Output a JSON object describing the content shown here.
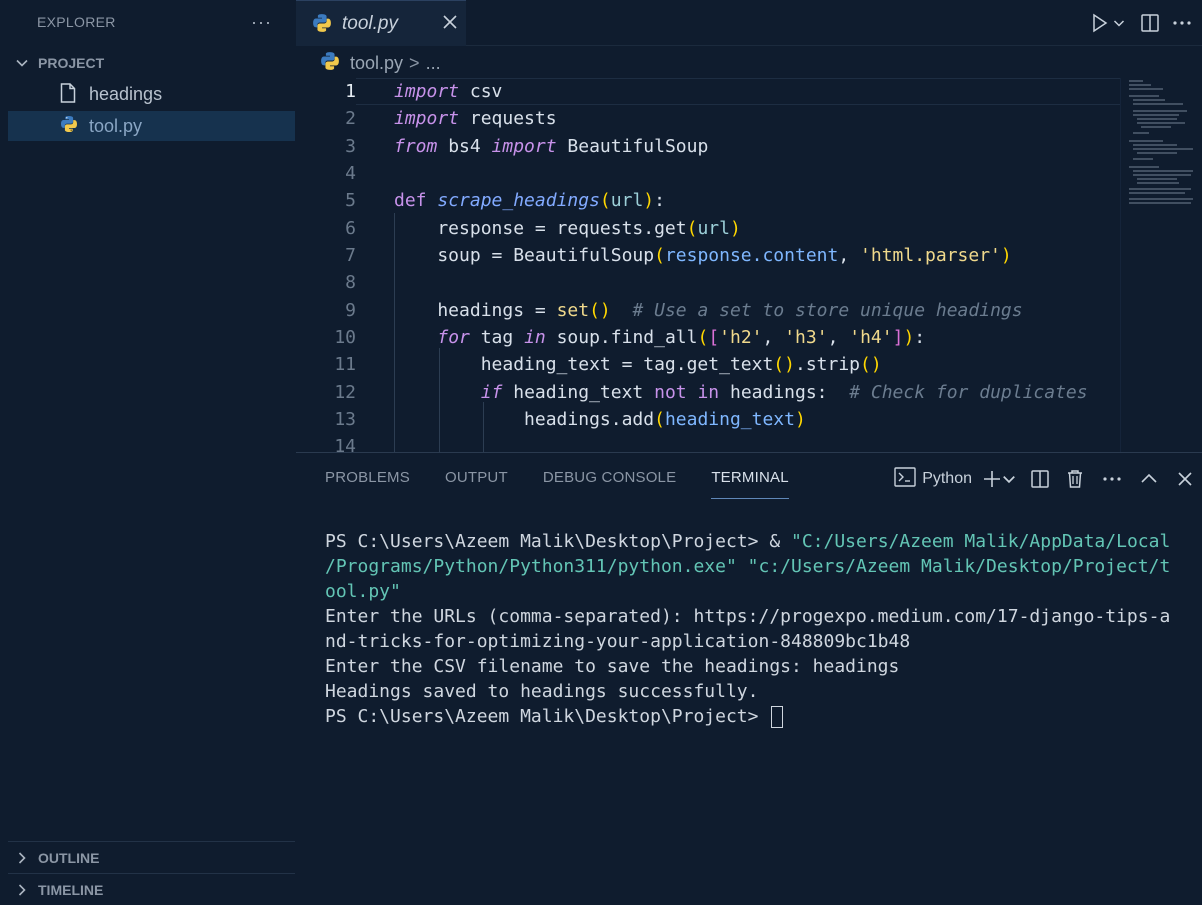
{
  "sidebar": {
    "title": "EXPLORER",
    "more": "···",
    "project_label": "PROJECT",
    "files": [
      {
        "name": "headings",
        "icon": "file-icon",
        "active": false
      },
      {
        "name": "tool.py",
        "icon": "python-icon",
        "active": true
      }
    ],
    "outline_label": "OUTLINE",
    "timeline_label": "TIMELINE"
  },
  "editor": {
    "tab": {
      "name": "tool.py",
      "icon": "python-icon"
    },
    "breadcrumb": {
      "file": "tool.py",
      "sep": ">",
      "more": "..."
    },
    "current_line": 1,
    "line_numbers": [
      "1",
      "2",
      "3",
      "4",
      "5",
      "6",
      "7",
      "8",
      "9",
      "10",
      "11",
      "12",
      "13",
      "14"
    ]
  },
  "panel": {
    "tabs": [
      "PROBLEMS",
      "OUTPUT",
      "DEBUG CONSOLE",
      "TERMINAL"
    ],
    "active_tab": "TERMINAL",
    "terminal_profile": "Python",
    "terminal": {
      "l1_prompt": "PS C:\\Users\\Azeem Malik\\Desktop\\Project> & ",
      "l1_str": "\"C:/Users/Azeem Malik/AppData/Local",
      "l2_str": "/Programs/Python/Python311/python.exe\" \"c:/Users/Azeem Malik/Desktop/Project/t",
      "l3_str": "ool.py\"",
      "l4": "Enter the URLs (comma-separated): https://progexpo.medium.com/17-django-tips-a",
      "l5": "nd-tricks-for-optimizing-your-application-848809bc1b48",
      "l6": "Enter the CSV filename to save the headings: headings",
      "l7": "Headings saved to headings successfully.",
      "l8": "PS C:\\Users\\Azeem Malik\\Desktop\\Project> "
    }
  },
  "colors": {
    "background": "#0f1c2e",
    "active_file": "#16324e",
    "keyword": "#c792ea",
    "function": "#82aaff",
    "string": "#f0d98c",
    "terminal_string": "#63c5b5"
  }
}
